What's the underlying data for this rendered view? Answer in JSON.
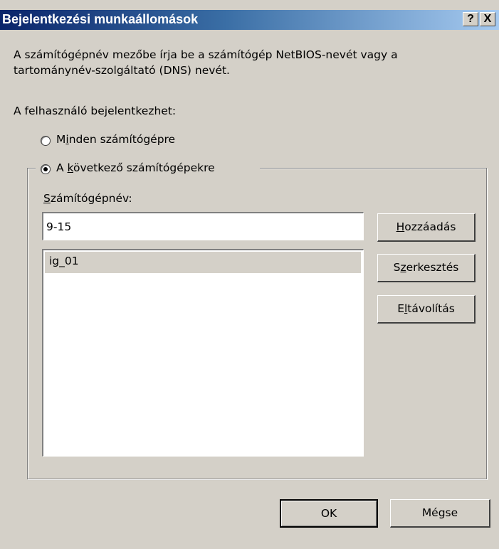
{
  "window": {
    "title": "Bejelentkezési munkaállomások",
    "help_glyph": "?",
    "close_glyph": "X"
  },
  "intro": {
    "line1": "A számítógépnév mezőbe írja be a számítógép NetBIOS-nevét vagy a",
    "line2": "tartománynév-szolgáltató (DNS) nevét."
  },
  "logon_label": "A felhasználó bejelentkezhet:",
  "radios": {
    "all": {
      "pre": "M",
      "accel": "i",
      "post": "nden számítógépre",
      "checked": false
    },
    "following": {
      "pre": "A ",
      "accel": "k",
      "post": "övetkező számítógépekre",
      "checked": true
    }
  },
  "computer_name": {
    "label_accel": "S",
    "label_rest": "zámítógépnév:",
    "value": "9-15"
  },
  "list": {
    "items": [
      "ig_01"
    ]
  },
  "buttons": {
    "add": {
      "accel": "H",
      "rest": "ozzáadás"
    },
    "edit": {
      "pre": "S",
      "accel": "z",
      "post": "erkesztés"
    },
    "remove": {
      "pre": "E",
      "accel": "l",
      "post": "távolítás"
    },
    "ok": "OK",
    "cancel": "Mégse"
  },
  "colors": {
    "face": "#d4d0c8",
    "title_start": "#0a246a",
    "title_end": "#a6caf0"
  }
}
